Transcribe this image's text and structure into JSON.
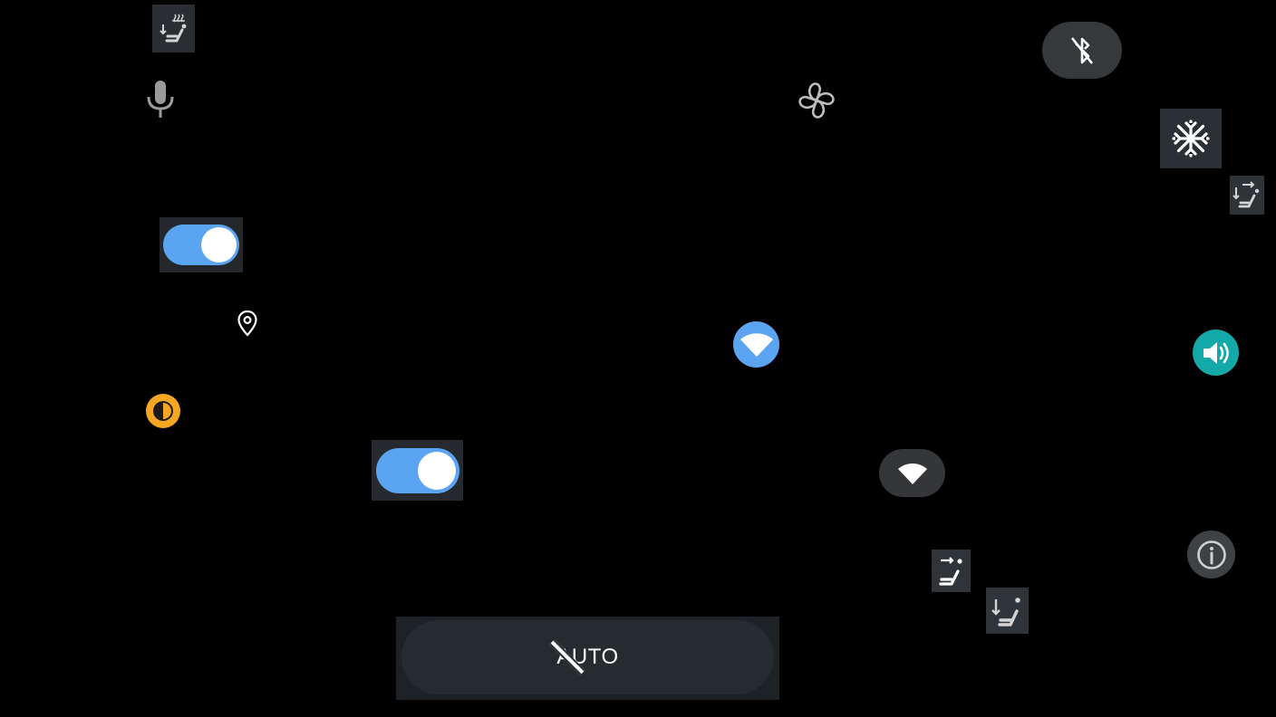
{
  "app": {
    "title": "",
    "background_color": "#000000"
  },
  "icons": {
    "seat_heat_lower_left": "seat-heat-icon",
    "microphone": "microphone-icon",
    "fan": "fan-icon",
    "bluetooth_off": "bluetooth-off-icon",
    "snowflake": "ac-snowflake-icon",
    "seat_airflow_right": "seat-airflow-icon",
    "location": "location-pin-icon",
    "brightness": "brightness-icon",
    "wifi_blue": "wifi-icon",
    "volume": "volume-icon",
    "wifi_pill": "wifi-icon",
    "info": "info-icon",
    "seat_airflow_face": "seat-airflow-face-icon",
    "seat_airflow_feet": "seat-airflow-feet-icon"
  },
  "toggles": {
    "toggle_one": {
      "state": "on",
      "track_color": "#5aa4f2"
    },
    "toggle_two": {
      "state": "on",
      "track_color": "#5aa4f2"
    }
  },
  "auto_button": {
    "label": "AUTO",
    "state": "off"
  },
  "colors": {
    "accent_blue": "#5aa4f2",
    "accent_teal": "#12a9a8",
    "accent_orange": "#f5a623",
    "icon_gray": "#c9c9c9",
    "button_dark": "#2a2e33",
    "pill_dark": "#36393c"
  }
}
